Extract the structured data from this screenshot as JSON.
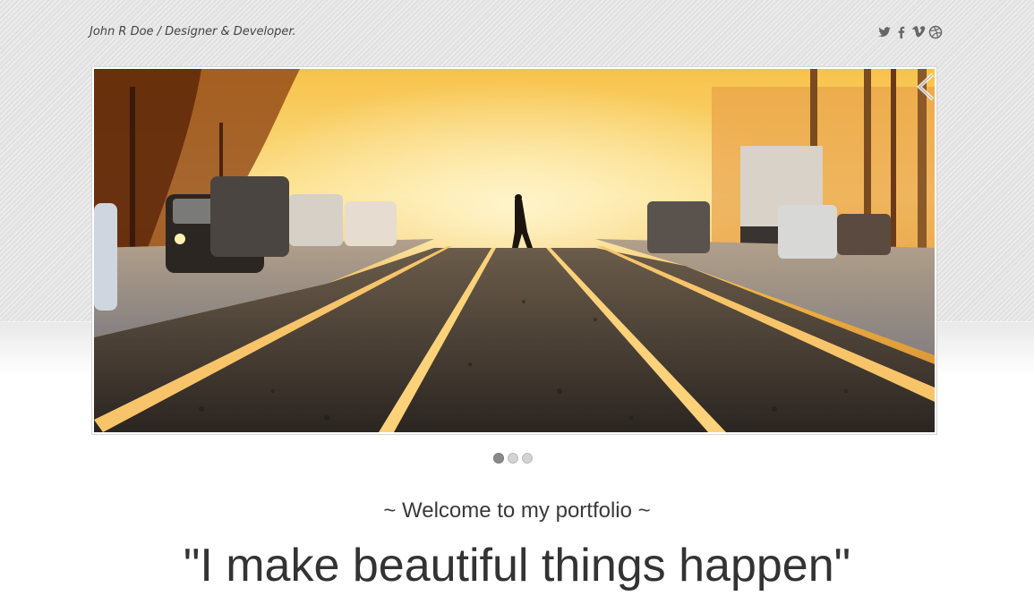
{
  "header": {
    "site_title": "John R Doe / Designer & Developer.",
    "social": [
      {
        "name": "twitter-icon"
      },
      {
        "name": "facebook-icon"
      },
      {
        "name": "vimeo-icon"
      },
      {
        "name": "dribbble-icon"
      }
    ]
  },
  "slider": {
    "slides_count": 3,
    "active_slide": 1,
    "current_image": "city-street-tram-tracks-sunset"
  },
  "intro": {
    "welcome": "~ Welcome to my portfolio ~",
    "headline": "\"I make beautiful things happen\""
  },
  "colors": {
    "background_texture": "#e2e2e2",
    "text": "#333333",
    "dot_active": "#8a8a8a",
    "dot_idle": "#d4d4d4"
  }
}
